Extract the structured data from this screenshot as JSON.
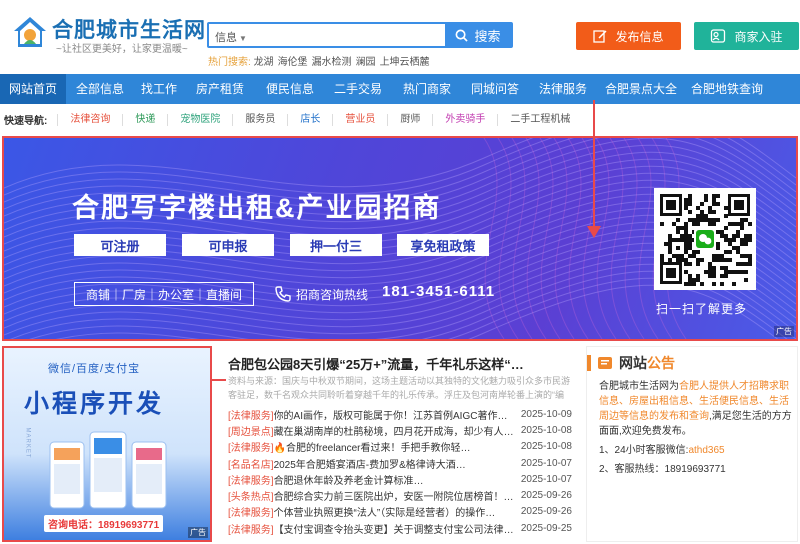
{
  "site": {
    "title": "合肥城市生活网",
    "slogan": "~让社区更美好，让家更温暖~"
  },
  "search": {
    "category": "信息",
    "placeholder": "",
    "button": "搜索",
    "hot_label": "热门搜索:",
    "hot_keywords": [
      "龙湖",
      "海伦堡",
      "漏水检测",
      "澜园",
      "上坤云栖麓"
    ]
  },
  "actions": {
    "post": "发布信息",
    "join": "商家入驻"
  },
  "nav": [
    "网站首页",
    "全部信息",
    "找工作",
    "房产租赁",
    "便民信息",
    "二手交易",
    "热门商家",
    "同城问答",
    "法律服务",
    "合肥景点大全",
    "合肥地铁查询"
  ],
  "quick_nav": {
    "title": "快速导航:",
    "items": [
      {
        "label": "法律咨询",
        "color": "#e6503c"
      },
      {
        "label": "快递",
        "color": "#2f9a5a"
      },
      {
        "label": "宠物医院",
        "color": "#2fa37c"
      },
      {
        "label": "服务员",
        "color": "#555555"
      },
      {
        "label": "店长",
        "color": "#1f6fc9"
      },
      {
        "label": "营业员",
        "color": "#e6503c"
      },
      {
        "label": "厨师",
        "color": "#555555"
      },
      {
        "label": "外卖骑手",
        "color": "#c23bb0"
      },
      {
        "label": "二手工程机械",
        "color": "#555555"
      }
    ]
  },
  "banner": {
    "title": "合肥写字楼出租&产业园招商",
    "pills": [
      "可注册",
      "可申报",
      "押一付三",
      "享免租政策"
    ],
    "types": "商铺｜厂房｜办公室｜直播间",
    "hotline_label": "招商咨询热线",
    "hotline_number": "181-3451-6111",
    "qr_caption": "扫一扫了解更多",
    "ad_tag": "广告"
  },
  "left_ad": {
    "top": "微信/百度/支付宝",
    "title": "小程序开发",
    "side": "MARKET",
    "contact": "咨询电话：18919693771",
    "ad_tag": "广告"
  },
  "news": {
    "headline": "合肥包公园8天引爆“25万+”流量，千年礼乐这样“…",
    "summary": "资料与来源：国庆与中秋双节期间，这场主题活动以其独特的文化魅力吸引众多市民游客驻足，数千名观众共同聆听着穿越千年的礼乐传承。浮庄及包河南岸轮番上演的“编年式演艺”，早上观演人次逼近一万。盛典风韵的《唐宫夜宴》、宋代",
    "items": [
      {
        "tag": "[法律服务]",
        "text": "你的AI画作，版权可能属于你！江苏首例AIGC著作…",
        "date": "2025-10-09"
      },
      {
        "tag": "[周边景点]",
        "text": "藏在巢湖南岸的杜鹃秘境，四月花开成海，却少有人知…",
        "date": "2025-10-08"
      },
      {
        "tag": "[法律服务]",
        "text": "合肥的freelancer看过来！手把手教你轻…",
        "date": "2025-10-08",
        "fire": true
      },
      {
        "tag": "[名品名店]",
        "text": "2025年合肥婚宴酒店-费加罗&格律诗大酒…",
        "date": "2025-10-07"
      },
      {
        "tag": "[法律服务]",
        "text": "合肥退休年龄及养老金计算标准…",
        "date": "2025-10-07"
      },
      {
        "tag": "[头条热点]",
        "text": "合肥综合实力前三医院出炉，安医一附院位居榜首！…",
        "date": "2025-09-26"
      },
      {
        "tag": "[法律服务]",
        "text": "个体营业执照更换“法人”（实际是经营者）的操作…",
        "date": "2025-09-26"
      },
      {
        "tag": "[法律服务]",
        "text": "【支付宝调查令抬头变更】关于调整支付宝公司法律文书…",
        "date": "2025-09-25"
      }
    ]
  },
  "notice": {
    "title_a": "网站",
    "title_b": "公告",
    "body_prefix": "合肥城市生活网为",
    "body_highlight": "合肥人提供人才招聘求职信息、房屋出租信息、生活便民信息、生活周边等信息的发布和查询",
    "body_suffix": ",满足您生活的方方面面,欢迎免费发布。",
    "item1_label": "1、24小时客服微信:",
    "item1_value": "athd365",
    "item2": "2、客服热线：18919693771"
  },
  "colors": {
    "brand_blue": "#2f86d8",
    "post_orange": "#f25c19",
    "join_teal": "#20b39a",
    "highlight_red": "#e84a4a",
    "notice_orange": "#f0882c"
  }
}
